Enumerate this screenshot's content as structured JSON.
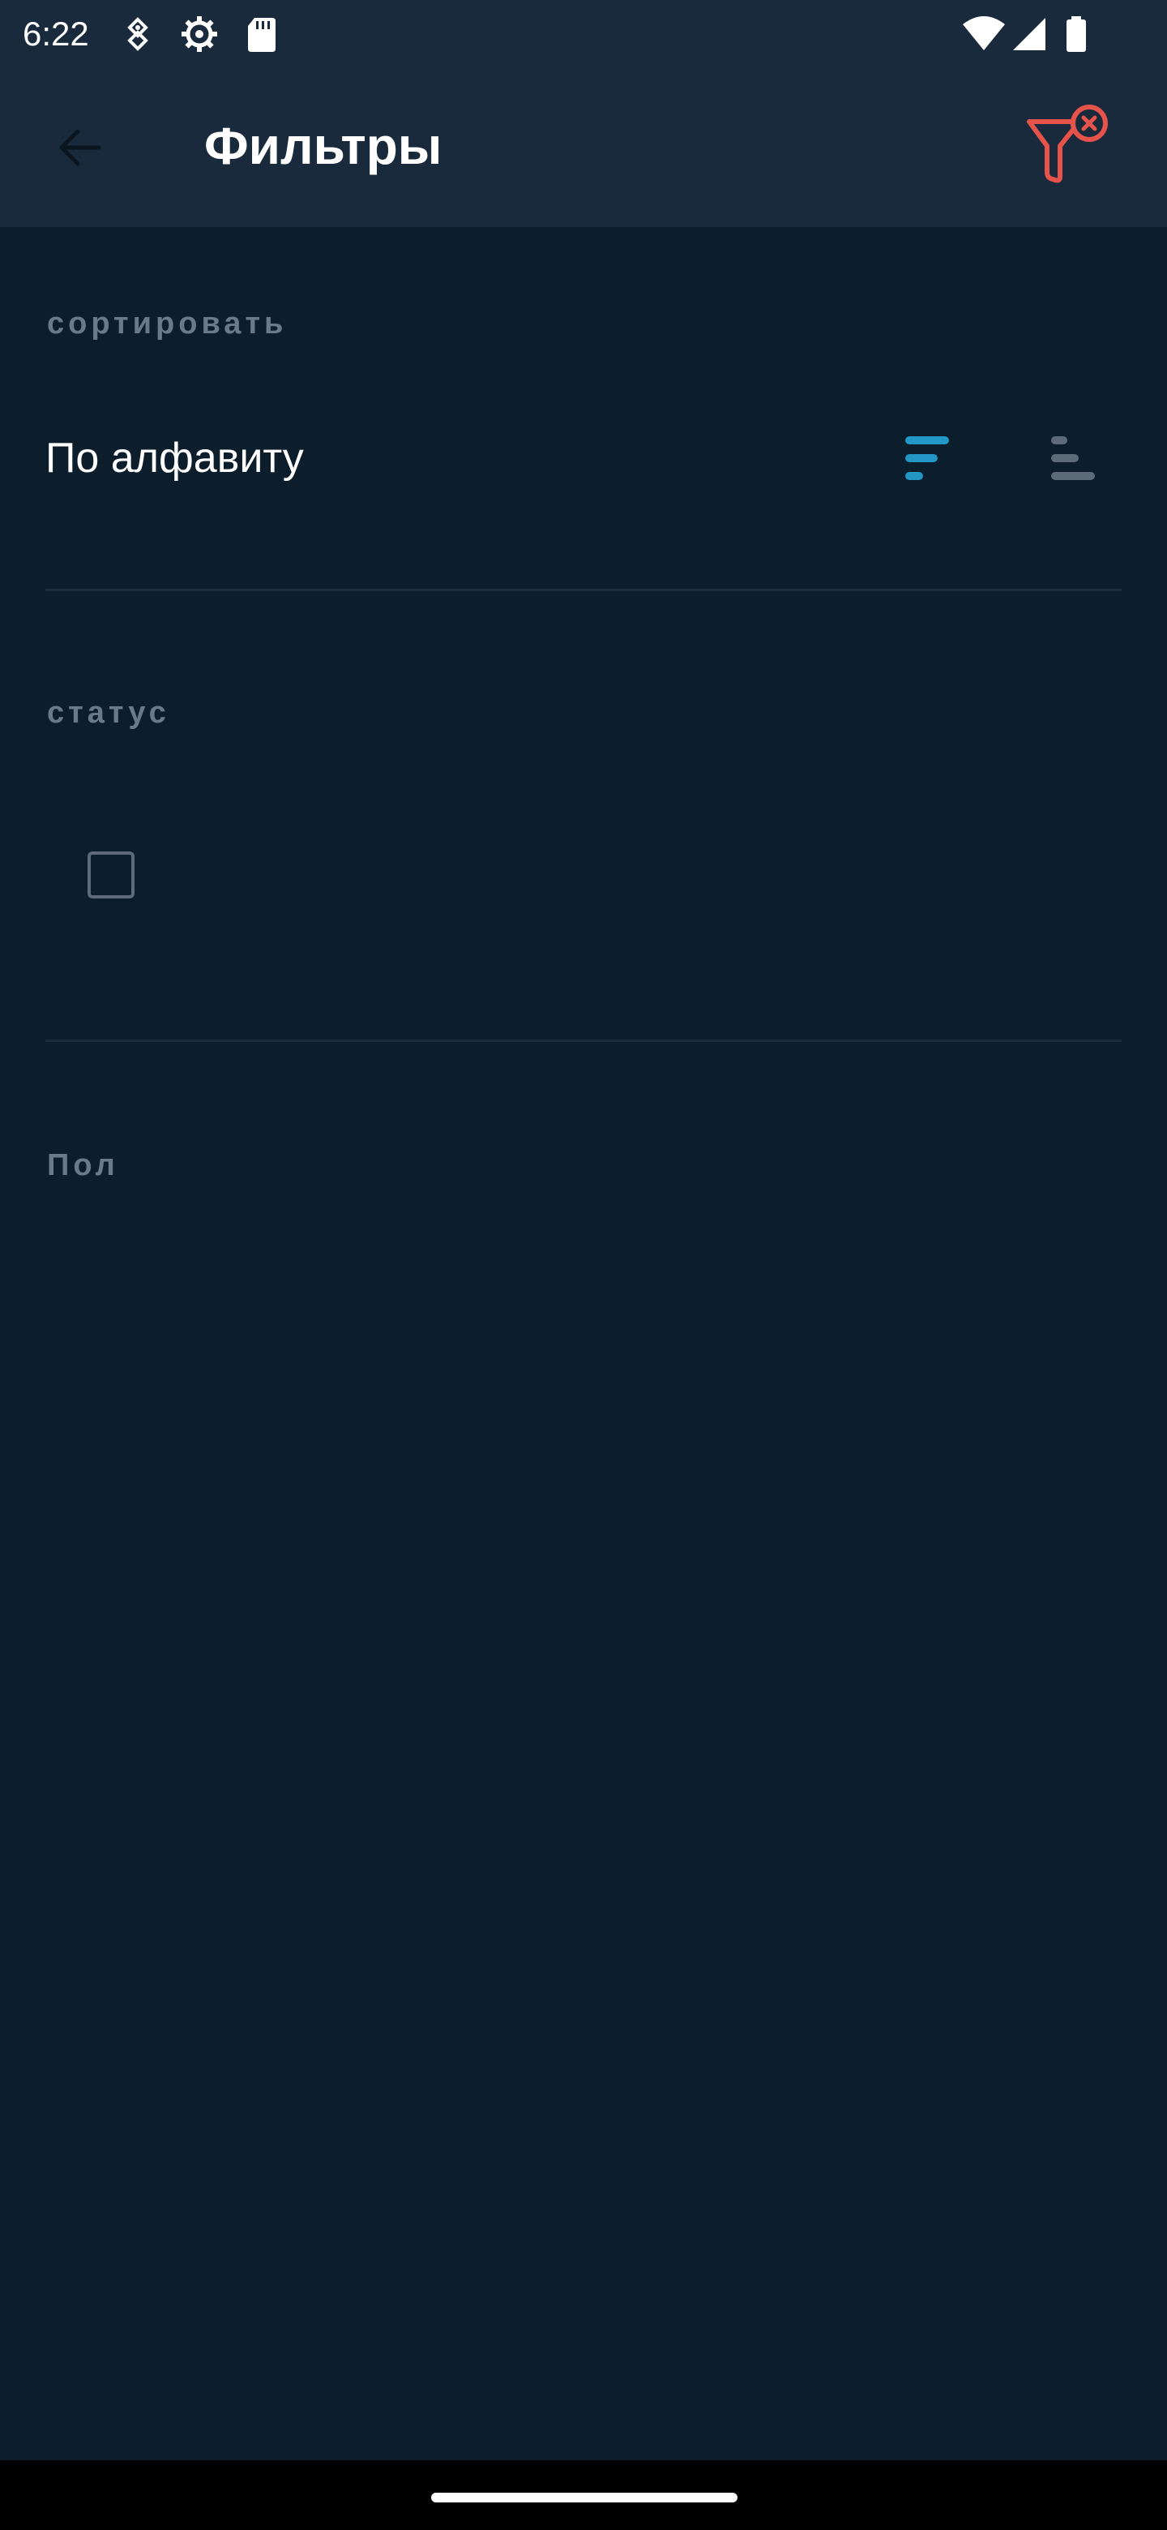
{
  "status_bar": {
    "time": "6:22",
    "icons": [
      "usb-debug-icon",
      "settings-gear-icon",
      "sd-card-icon",
      "wifi-icon",
      "cell-signal-icon",
      "battery-icon"
    ]
  },
  "toolbar": {
    "title": "Фильтры",
    "back_icon": "arrow-left-icon",
    "clear_icon": "filter-remove-icon"
  },
  "sort_section": {
    "header": "сортировать",
    "option_label": "По алфавиту",
    "ascending_icon": "sort-ascending-icon",
    "descending_icon": "sort-descending-icon"
  },
  "status_section": {
    "header": "статус",
    "checkbox_checked": false
  },
  "gender_section": {
    "header": "Пол"
  },
  "colors": {
    "background": "#0c1d2c",
    "toolbar": "#182a3b",
    "accent": "#2296c4",
    "danger": "#e5534b",
    "muted": "#6b7a89"
  }
}
